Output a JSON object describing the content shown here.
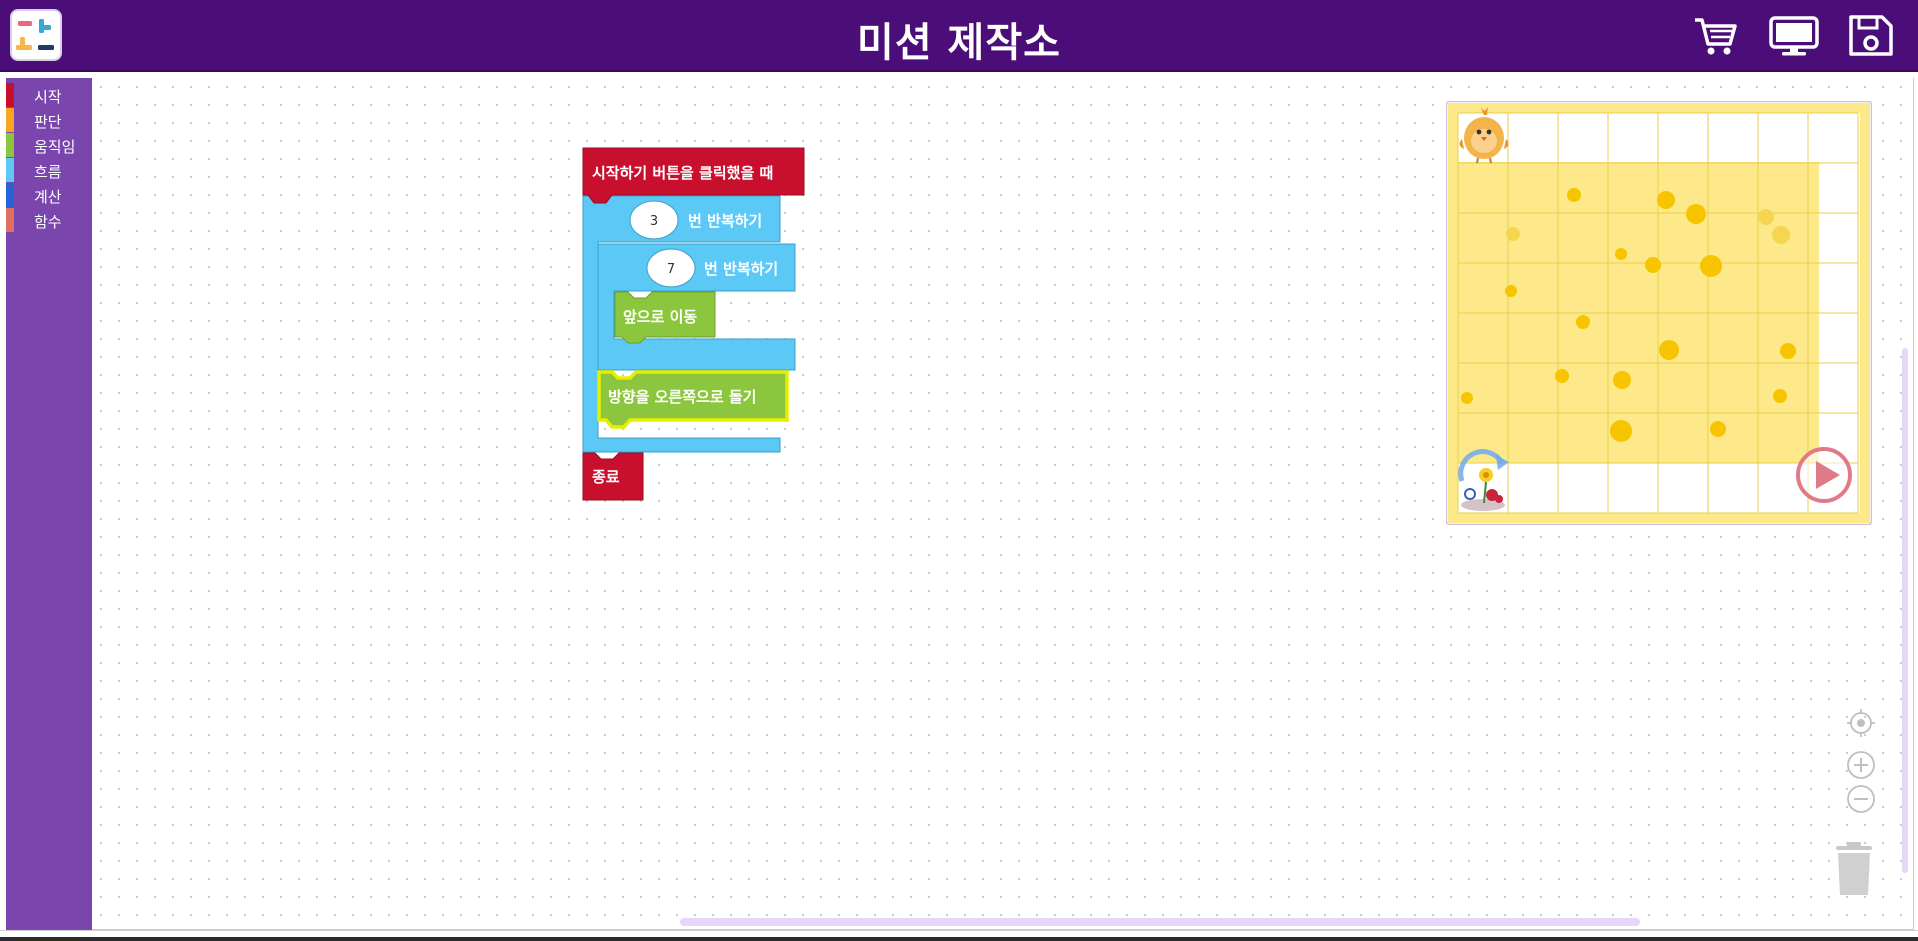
{
  "header": {
    "title": "미션 제작소",
    "icons": [
      "logo-icon",
      "cart-icon",
      "monitor-icon",
      "save-icon"
    ],
    "background": "#4b0e78"
  },
  "categories": [
    {
      "label": "시작",
      "color": "#c8102e"
    },
    {
      "label": "판단",
      "color": "#f5a623"
    },
    {
      "label": "움직임",
      "color": "#8cc63f"
    },
    {
      "label": "흐름",
      "color": "#5bc8f5"
    },
    {
      "label": "계산",
      "color": "#2462d6"
    },
    {
      "label": "함수",
      "color": "#e07060"
    }
  ],
  "blocks": {
    "start": "시작하기 버튼을 클릭했을 때",
    "outer_repeat_count": "3",
    "outer_repeat_label": "번 반복하기",
    "inner_repeat_count": "7",
    "inner_repeat_label": "번 반복하기",
    "move_forward": "앞으로 이동",
    "turn_right": "방향을 오른쪽으로 돌기",
    "end": "종료"
  },
  "colors": {
    "start_block": "#c8102e",
    "flow_block": "#5bc8f5",
    "motion_block": "#8cc63f",
    "highlight": "#e8ee00",
    "map_yellow": "#fde98a"
  },
  "stage": {
    "characters": [
      "chick-icon",
      "flower-goal-icon"
    ],
    "controls": [
      "play-icon",
      "reset-icon"
    ]
  },
  "workspace_controls": [
    "center-icon",
    "zoom-in-icon",
    "zoom-out-icon",
    "trash-icon"
  ]
}
